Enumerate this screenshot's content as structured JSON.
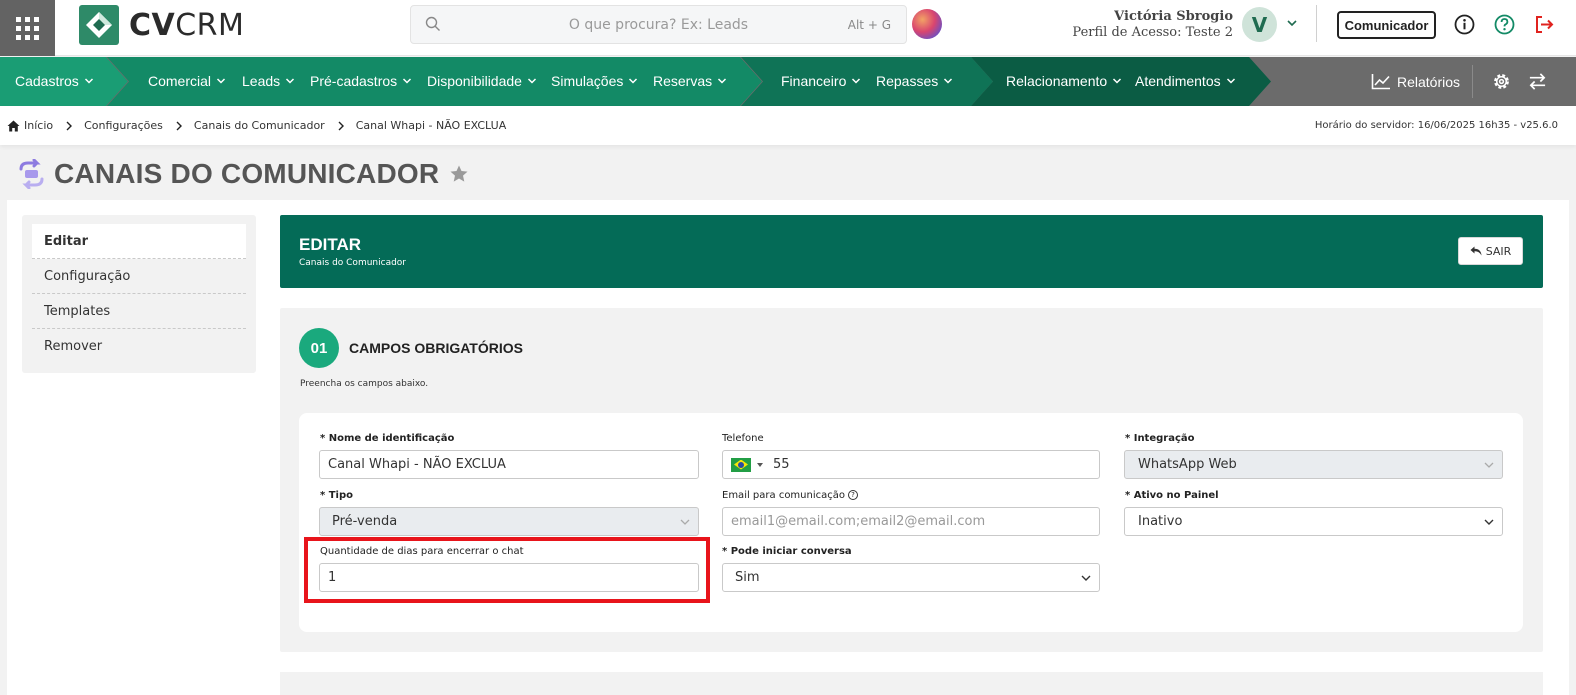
{
  "app": {
    "brand_bold": "CV",
    "brand_light": "CRM"
  },
  "search": {
    "placeholder": "O que procura? Ex: Leads",
    "shortcut": "Alt + G"
  },
  "user": {
    "name": "Victória Sbrogio",
    "profile": "Perfil de Acesso: Teste 2",
    "initial": "V"
  },
  "topbar": {
    "comunicador_label": "Comunicador"
  },
  "nav": {
    "items": [
      {
        "label": "Cadastros"
      },
      {
        "label": "Comercial"
      },
      {
        "label": "Leads"
      },
      {
        "label": "Pré-cadastros"
      },
      {
        "label": "Disponibilidade"
      },
      {
        "label": "Simulações"
      },
      {
        "label": "Reservas"
      },
      {
        "label": "Financeiro"
      },
      {
        "label": "Repasses"
      },
      {
        "label": "Relacionamento"
      },
      {
        "label": "Atendimentos"
      }
    ],
    "reports_label": "Relatórios"
  },
  "breadcrumb": {
    "items": [
      "Início",
      "Configurações",
      "Canais do Comunicador",
      "Canal Whapi - NÃO EXCLUA"
    ],
    "server_time": "Horário do servidor: 16/06/2025 16h35 - v25.6.0"
  },
  "page": {
    "title": "CANAIS DO COMUNICADOR"
  },
  "sidebar": {
    "items": [
      {
        "label": "Editar",
        "active": true
      },
      {
        "label": "Configuração"
      },
      {
        "label": "Templates"
      },
      {
        "label": "Remover"
      }
    ]
  },
  "header": {
    "title": "EDITAR",
    "subtitle": "Canais do Comunicador",
    "exit_label": "SAIR"
  },
  "section": {
    "number": "01",
    "title": "CAMPOS OBRIGATÓRIOS",
    "description": "Preencha os campos abaixo."
  },
  "form": {
    "nome": {
      "label": "Nome de identificação",
      "value": "Canal Whapi - NÃO EXCLUA"
    },
    "telefone": {
      "label": "Telefone",
      "value": "55"
    },
    "integracao": {
      "label": "Integração",
      "value": "WhatsApp Web"
    },
    "tipo": {
      "label": "Tipo",
      "value": "Pré-venda"
    },
    "email": {
      "label": "Email para comunicação",
      "placeholder": "email1@email.com;email2@email.com"
    },
    "ativo": {
      "label": "Ativo no Painel",
      "value": "Inativo"
    },
    "dias": {
      "label": "Quantidade de dias para encerrar o chat",
      "value": "1"
    },
    "iniciar": {
      "label": "Pode iniciar conversa",
      "value": "Sim"
    }
  },
  "colors": {
    "primary": "#046b57",
    "accent": "#1aa97d",
    "highlight": "#e8141b"
  }
}
